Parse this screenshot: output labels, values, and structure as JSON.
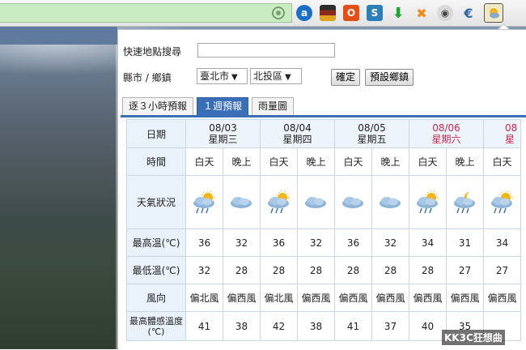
{
  "popup": {
    "search_label": "快速地點搜尋",
    "search_value": "",
    "district_label": "縣市 / 鄉鎮",
    "city_select": "臺北市",
    "district_select": "北投區",
    "confirm_button": "確定",
    "default_button": "預設鄉鎮"
  },
  "tabs": [
    {
      "label": "逐３小時預報",
      "active": false
    },
    {
      "label": "１週預報",
      "active": true
    },
    {
      "label": "雨量圖",
      "active": false
    }
  ],
  "forecast": {
    "row_labels": {
      "date": "日期",
      "time": "時間",
      "weather": "天氣狀況",
      "max_temp": "最高溫(℃)",
      "min_temp": "最低溫(℃)",
      "wind": "風向",
      "feels": "最高體感溫度(℃)"
    },
    "day_label": "白天",
    "night_label": "晚上",
    "days": [
      {
        "date": "08/03",
        "weekday": "星期三",
        "weekend": false
      },
      {
        "date": "08/04",
        "weekday": "星期四",
        "weekend": false
      },
      {
        "date": "08/05",
        "weekday": "星期五",
        "weekend": false
      },
      {
        "date": "08/06",
        "weekday": "星期六",
        "weekend": true
      },
      {
        "date": "08",
        "weekday": "星",
        "weekend": true
      }
    ],
    "columns": [
      {
        "weather": "rain-sun",
        "max": "36",
        "min": "32",
        "wind": "偏北風",
        "feels": "41"
      },
      {
        "weather": "cloud",
        "max": "32",
        "min": "28",
        "wind": "偏西風",
        "feels": "38"
      },
      {
        "weather": "rain-sun",
        "max": "36",
        "min": "28",
        "wind": "偏北風",
        "feels": "42"
      },
      {
        "weather": "cloud",
        "max": "32",
        "min": "28",
        "wind": "偏西風",
        "feels": "38"
      },
      {
        "weather": "cloud",
        "max": "36",
        "min": "28",
        "wind": "偏西風",
        "feels": "41"
      },
      {
        "weather": "cloud",
        "max": "32",
        "min": "28",
        "wind": "偏西風",
        "feels": "37"
      },
      {
        "weather": "rain-sun",
        "max": "34",
        "min": "28",
        "wind": "偏西風",
        "feels": "40"
      },
      {
        "weather": "rain-moon",
        "max": "31",
        "min": "27",
        "wind": "偏西風",
        "feels": "35"
      },
      {
        "weather": "rain-sun",
        "max": "34",
        "min": "27",
        "wind": "偏西風",
        "feels": ""
      }
    ]
  },
  "watermark": "KK3C狂想曲",
  "extensions": [
    {
      "icon": "ad-icon",
      "color": "#1c6fc7"
    },
    {
      "icon": "keyboard-icon",
      "color": "#6a2a1a"
    },
    {
      "icon": "office-icon",
      "color": "#e24f17"
    },
    {
      "icon": "s-icon",
      "color": "#2c7fb8"
    },
    {
      "icon": "download-arrow-icon",
      "color": "#24a33b"
    },
    {
      "icon": "sparkle-icon",
      "color": "#f08a1c"
    },
    {
      "icon": "owl-icon",
      "color": "#6b6b6b"
    },
    {
      "icon": "euro-icon",
      "color": "#2d62a8"
    },
    {
      "icon": "weather-icon",
      "color": "#f0e9c8"
    }
  ]
}
